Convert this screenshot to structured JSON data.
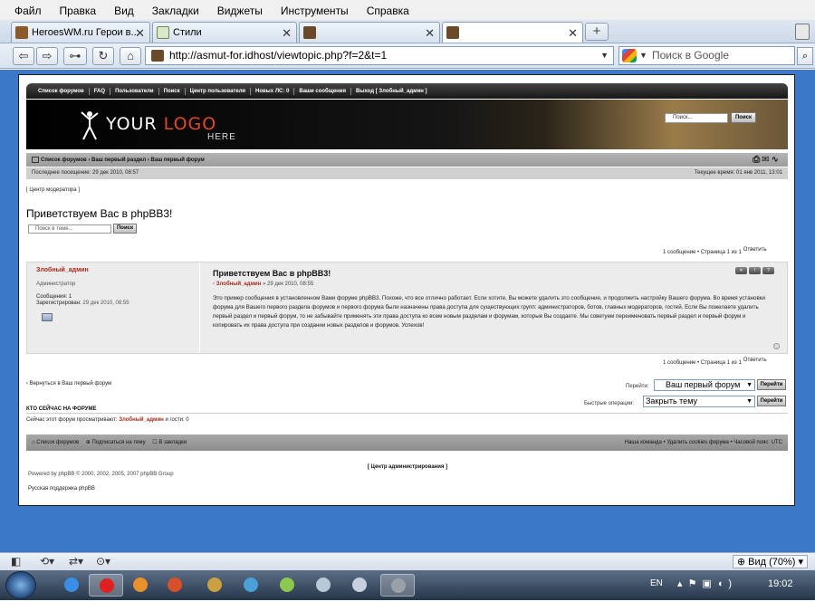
{
  "browser": {
    "menu": [
      "Файл",
      "Правка",
      "Вид",
      "Закладки",
      "Виджеты",
      "Инструменты",
      "Справка"
    ],
    "tabs": [
      {
        "label": "HeroesWM.ru Герои в...",
        "icon": "helmet-icon",
        "active": false
      },
      {
        "label": "Стили",
        "icon": "page-icon",
        "active": false
      },
      {
        "label": "",
        "icon": "forum-favicon-icon",
        "active": false
      },
      {
        "label": "",
        "icon": "forum-favicon-icon",
        "active": true
      }
    ],
    "url": "http://asmut-for.idhost/viewtopic.php?f=2&t=1",
    "search_placeholder": "Поиск в Google",
    "zoom": "Вид (70%)"
  },
  "forum": {
    "topnav": [
      "Список форумов",
      "FAQ",
      "Пользователи",
      "Поиск",
      "Центр пользователя",
      "Новых ЛС: 0",
      "Ваши сообщения",
      "Выход [ Злобный_админ ]"
    ],
    "logo_main": "YOUR ",
    "logo_accent": "LOGO",
    "logo_sub": "HERE",
    "header_search_placeholder": "Поиск...",
    "header_search_btn": "Поиск",
    "breadcrumb": "Список форумов ‹ Ваш первый раздел ‹ Ваш первый форум",
    "last_visit": "Последнее посещение: 29 дек 2010, 08:57",
    "current_time": "Текущее время: 01 янв 2011, 13:01",
    "mod_center": "[ Центр модератора ]",
    "topic_title": "Приветствуем Вас в phpBB3!",
    "topic_search_placeholder": "Поиск в теме...",
    "topic_search_btn": "Поиск",
    "pagination": "1 сообщение • Страница 1 из 1",
    "reply_label": "Ответить",
    "post": {
      "author": "Злобный_админ",
      "rank": "Администратор",
      "messages": "Сообщения: 1",
      "registered_label": "Зарегистрирован:",
      "registered_value": "29 дек 2010, 08:55",
      "subject": "Приветствуем Вас в phpBB3!",
      "meta_prefix": "Злобный_админ",
      "meta_suffix": " » 29 дек 2010, 08:55",
      "body": "Это пример сообщения в установленном Вами форуме phpBB3. Похоже, что все отлично работает. Если хотите, Вы можете удалить это сообщение, и продолжить настройку Вашего форума. Во время установки форума для Вашего первого раздела форумов и первого форума были назначены права доступа для существующих групп: администраторов, ботов, главных модераторов, гостей. Если Вы пожелаете удалить первый раздел и первый форум, то не забывайте применять эти права доступа ко всем новым разделам и форумам, которые Вы создаете. Мы советуем переименовать первый раздел и первый форум и копировать их права доступа при создании новых разделов и форумов. Успехов!"
    },
    "back_link": "‹ Вернуться в Ваш первый форум",
    "jump_label": "Перейти:",
    "jump_value": "Ваш первый форум",
    "go_btn": "Перейти",
    "quick_label": "Быстрые операции:",
    "quick_value": "Закрыть тему",
    "who_heading": "КТО СЕЙЧАС НА ФОРУМЕ",
    "who_prefix": "Сейчас этот форум просматривают: ",
    "who_user": "Злобный_админ",
    "who_suffix": " и гости: 0",
    "footer_left": [
      "Список форумов",
      "Подписаться на тему",
      "В закладки"
    ],
    "footer_right": "Наша команда • Удалить cookies форума • Часовой пояс: UTC",
    "admin_link": "[ Центр администрирования ]",
    "powered": "Powered by phpBB © 2000, 2002, 2005, 2007 phpBB Group",
    "russian": "Русская поддержка phpBB"
  },
  "taskbar": {
    "lang": "EN",
    "time": "19:02"
  }
}
